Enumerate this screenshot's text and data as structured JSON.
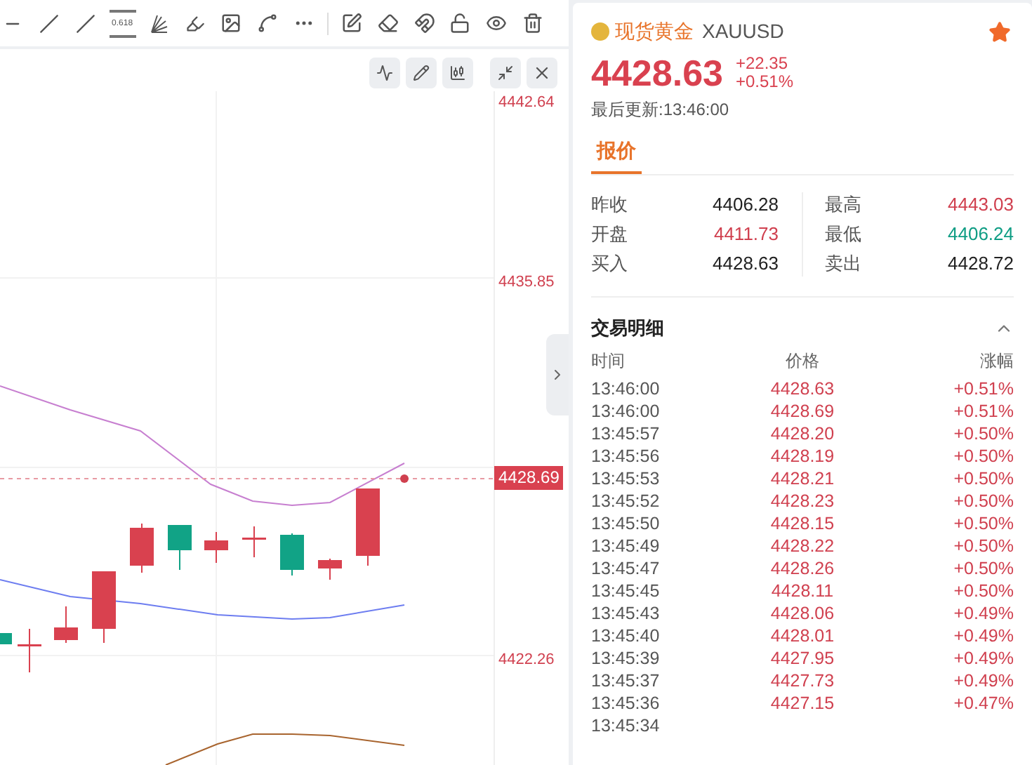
{
  "toolbar": {
    "fib_label": "0.618"
  },
  "chart": {
    "y_axis_labels": [
      "4442.64",
      "4435.85",
      "4422.26"
    ],
    "current_price": "4428.69"
  },
  "quote": {
    "name": "现货黄金",
    "symbol": "XAUUSD",
    "favorite": true,
    "price": "4428.63",
    "change": "+22.35",
    "change_pct": "+0.51%",
    "updated": "最后更新:13:46:00"
  },
  "tabs": [
    {
      "label": "报价",
      "selected": true
    }
  ],
  "stats": [
    {
      "label": "昨收",
      "value": "4406.28",
      "color": "#222222"
    },
    {
      "label": "最高",
      "value": "4443.03",
      "color": "#d0404f"
    },
    {
      "label": "开盘",
      "value": "4411.73",
      "color": "#d0404f"
    },
    {
      "label": "最低",
      "value": "4406.24",
      "color": "#0f9d84"
    },
    {
      "label": "买入",
      "value": "4428.63",
      "color": "#222222"
    },
    {
      "label": "卖出",
      "value": "4428.72",
      "color": "#222222"
    }
  ],
  "trades": {
    "title": "交易明细",
    "expanded": true,
    "columns": [
      "时间",
      "价格",
      "涨幅"
    ],
    "rows": [
      {
        "time": "13:46:00",
        "price": "4428.63",
        "change": "+0.51%"
      },
      {
        "time": "13:46:00",
        "price": "4428.69",
        "change": "+0.51%"
      },
      {
        "time": "13:45:57",
        "price": "4428.20",
        "change": "+0.50%"
      },
      {
        "time": "13:45:56",
        "price": "4428.19",
        "change": "+0.50%"
      },
      {
        "time": "13:45:53",
        "price": "4428.21",
        "change": "+0.50%"
      },
      {
        "time": "13:45:52",
        "price": "4428.23",
        "change": "+0.50%"
      },
      {
        "time": "13:45:50",
        "price": "4428.15",
        "change": "+0.50%"
      },
      {
        "time": "13:45:49",
        "price": "4428.22",
        "change": "+0.50%"
      },
      {
        "time": "13:45:47",
        "price": "4428.26",
        "change": "+0.50%"
      },
      {
        "time": "13:45:45",
        "price": "4428.11",
        "change": "+0.50%"
      },
      {
        "time": "13:45:43",
        "price": "4428.06",
        "change": "+0.49%"
      },
      {
        "time": "13:45:40",
        "price": "4428.01",
        "change": "+0.49%"
      },
      {
        "time": "13:45:39",
        "price": "4427.95",
        "change": "+0.49%"
      },
      {
        "time": "13:45:37",
        "price": "4427.73",
        "change": "+0.49%"
      },
      {
        "time": "13:45:36",
        "price": "4427.15",
        "change": "+0.47%"
      },
      {
        "time": "13:45:34"
      }
    ]
  }
}
